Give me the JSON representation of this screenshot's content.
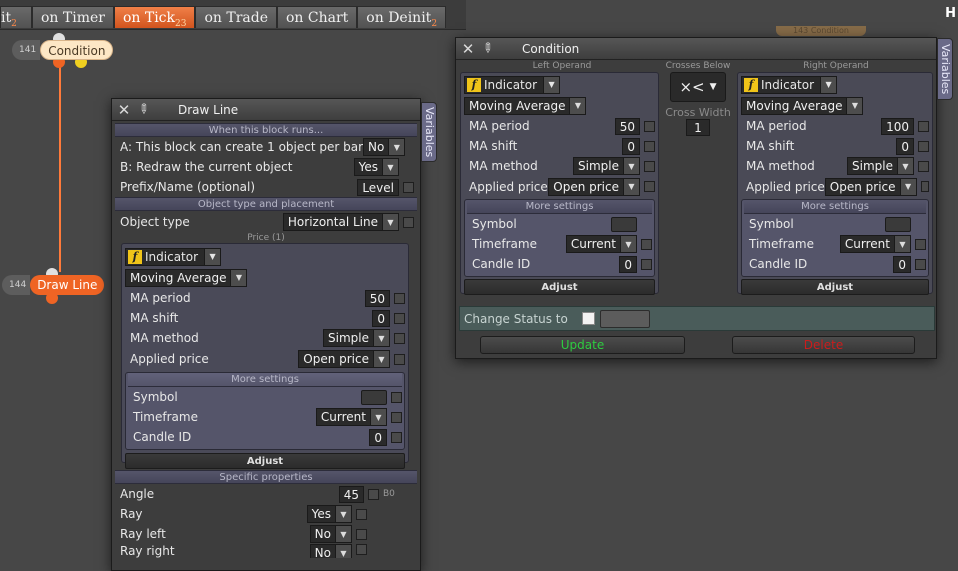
{
  "tabs": [
    {
      "label": "it",
      "count": "2"
    },
    {
      "label": "on Timer",
      "count": ""
    },
    {
      "label": "on Tick",
      "count": "23"
    },
    {
      "label": "on Trade",
      "count": ""
    },
    {
      "label": "on Chart",
      "count": ""
    },
    {
      "label": "on Deinit",
      "count": "2"
    }
  ],
  "corner_letter": "H",
  "ghost_node_label": "143 Condition",
  "nodes": {
    "condition": {
      "num": "141",
      "label": "Condition"
    },
    "drawline": {
      "num": "144",
      "label": "Draw Line"
    }
  },
  "colors": {
    "accent": "#ef6424",
    "active_tab": "#e66a30",
    "wire": "#ff7a3a",
    "update": "#2ecc40",
    "delete": "#cc1c1c"
  },
  "draw_line": {
    "title": "Draw Line",
    "variables_tab": "Variables",
    "section_when": "When this block runs...",
    "row_a": {
      "label": "A: This block can create 1 object per bar",
      "value": "No"
    },
    "row_b": {
      "label": "B: Redraw the current object",
      "value": "Yes"
    },
    "row_prefix": {
      "label": "Prefix/Name (optional)",
      "value": "Level"
    },
    "section_object": "Object type and placement",
    "object_type": {
      "label": "Object type",
      "value": "Horizontal Line"
    },
    "price_caption": "Price (1)",
    "indicator_button": "Indicator",
    "indicator_select": "Moving Average",
    "ma_period": {
      "label": "MA period",
      "value": "50"
    },
    "ma_shift": {
      "label": "MA shift",
      "value": "0"
    },
    "ma_method": {
      "label": "MA method",
      "value": "Simple"
    },
    "applied_price": {
      "label": "Applied price",
      "value": "Open price"
    },
    "more_settings": "More settings",
    "symbol": {
      "label": "Symbol"
    },
    "timeframe": {
      "label": "Timeframe",
      "value": "Current"
    },
    "candle_id": {
      "label": "Candle ID",
      "value": "0"
    },
    "adjust": "Adjust",
    "section_specific": "Specific properties",
    "angle": {
      "label": "Angle",
      "value": "45",
      "suffix": "B0"
    },
    "ray": {
      "label": "Ray",
      "value": "Yes"
    },
    "ray_left": {
      "label": "Ray left",
      "value": "No"
    },
    "ray_right": {
      "label": "Ray right",
      "value": "No"
    }
  },
  "condition": {
    "title": "Condition",
    "variables_tab": "Variables",
    "left_caption": "Left Operand",
    "right_caption": "Right Operand",
    "crosses_caption": "Crosses Below",
    "operator": "×<",
    "cross_width_label": "Cross Width",
    "cross_width_value": "1",
    "left": {
      "indicator_button": "Indicator",
      "indicator_select": "Moving Average",
      "ma_period": {
        "label": "MA period",
        "value": "50"
      },
      "ma_shift": {
        "label": "MA shift",
        "value": "0"
      },
      "ma_method": {
        "label": "MA method",
        "value": "Simple"
      },
      "applied_price": {
        "label": "Applied price",
        "value": "Open price"
      },
      "more_settings": "More settings",
      "symbol": "Symbol",
      "timeframe": {
        "label": "Timeframe",
        "value": "Current"
      },
      "candle_id": {
        "label": "Candle ID",
        "value": "0"
      },
      "adjust": "Adjust"
    },
    "right": {
      "indicator_button": "Indicator",
      "indicator_select": "Moving Average",
      "ma_period": {
        "label": "MA period",
        "value": "100"
      },
      "ma_shift": {
        "label": "MA shift",
        "value": "0"
      },
      "ma_method": {
        "label": "MA method",
        "value": "Simple"
      },
      "applied_price": {
        "label": "Applied price",
        "value": "Open price"
      },
      "more_settings": "More settings",
      "symbol": "Symbol",
      "timeframe": {
        "label": "Timeframe",
        "value": "Current"
      },
      "candle_id": {
        "label": "Candle ID",
        "value": "0"
      },
      "adjust": "Adjust"
    },
    "change_status_label": "Change Status to",
    "update_button": "Update",
    "delete_button": "Delete"
  }
}
